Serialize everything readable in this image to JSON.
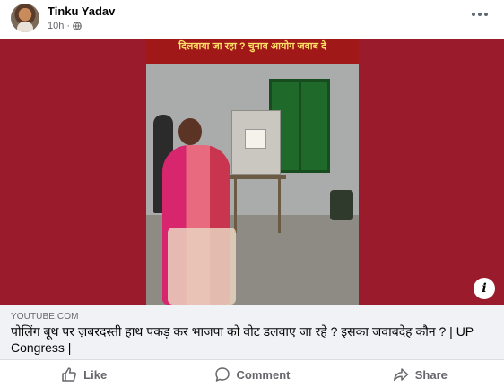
{
  "post": {
    "author": "Tinku Yadav",
    "time": "10h",
    "separator": "·",
    "privacy_icon": "globe-icon",
    "more_icon": "more-options-icon"
  },
  "video": {
    "banner_text": "दिलवाया जा रहा ? चुनाव आयोग जवाब दे",
    "info_icon_label": "i"
  },
  "link": {
    "domain": "YOUTUBE.COM",
    "title": "पोलिंग बूथ पर ज़बरदस्ती हाथ पकड़ कर भाजपा को वोट डलवाए जा रहे ? इसका जवाबदेह कौन ? | UP Congress |"
  },
  "actions": {
    "like": "Like",
    "comment": "Comment",
    "share": "Share"
  },
  "colors": {
    "media_background": "#9a1c2c",
    "banner_background": "#a01818",
    "banner_text": "#ffe066",
    "muted_text": "#65676b"
  }
}
